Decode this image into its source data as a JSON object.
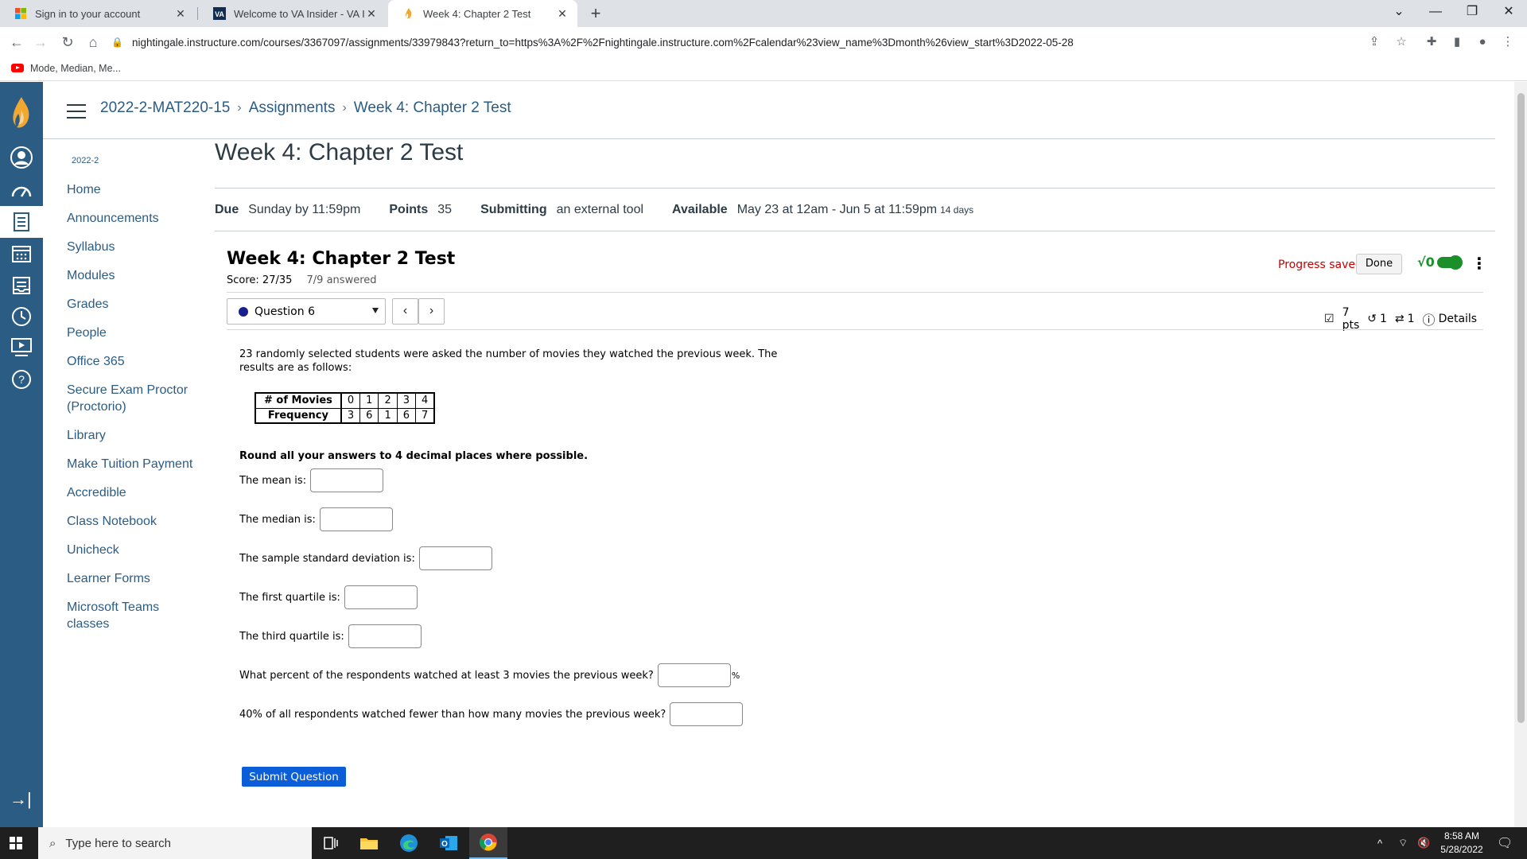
{
  "browser": {
    "tabs": [
      {
        "title": "Sign in to your account",
        "close": "✕"
      },
      {
        "title": "Welcome to VA Insider - VA INSI",
        "close": "✕"
      },
      {
        "title": "Week 4: Chapter 2 Test",
        "close": "✕"
      }
    ],
    "new_tab": "+",
    "url": "nightingale.instructure.com/courses/3367097/assignments/33979843?return_to=https%3A%2F%2Fnightingale.instructure.com%2Fcalendar%23view_name%3Dmonth%26view_start%3D2022-05-28",
    "bookmarks": [
      {
        "label": "Mode, Median, Me..."
      }
    ],
    "window_controls": {
      "chevron": "⌄",
      "minimize": "—",
      "restore": "❐",
      "close": "✕"
    },
    "va_favicon": "VA"
  },
  "canvas": {
    "breadcrumbs": [
      "2022-2-MAT220-15",
      "Assignments",
      "Week 4: Chapter 2 Test"
    ],
    "breadcrumb_sep": "›",
    "term": "2022-2",
    "course_nav": [
      "Home",
      "Announcements",
      "Syllabus",
      "Modules",
      "Grades",
      "People",
      "Office 365",
      "Secure Exam Proctor (Proctorio)",
      "Library",
      "Make Tuition Payment",
      "Accredible",
      "Class Notebook",
      "Unicheck",
      "Learner Forms",
      "Microsoft Teams classes"
    ],
    "page_title": "Week 4: Chapter 2 Test",
    "meta": {
      "due_label": "Due",
      "due_value": "Sunday by 11:59pm",
      "points_label": "Points",
      "points_value": "35",
      "submitting_label": "Submitting",
      "submitting_value": "an external tool",
      "available_label": "Available",
      "available_value": "May 23 at 12am - Jun 5 at 11:59pm",
      "available_days": "14 days"
    },
    "collapse_icon": "→|"
  },
  "tool": {
    "title": "Week 4: Chapter 2 Test",
    "score": "Score: 27/35",
    "answered": "7/9 answered",
    "progress_saved": "Progress saved",
    "done_label": "Done",
    "math_label": "√0",
    "kebab": "⋮",
    "question_select": "Question 6",
    "prev": "‹",
    "next": "›",
    "pts": "7 pts",
    "retries": "1",
    "regens": "1",
    "details": "Details",
    "question_text": "23 randomly selected students were asked the number of movies they watched the previous week. The results are as follows:",
    "table": {
      "row1_label": "# of Movies",
      "row1": [
        "0",
        "1",
        "2",
        "3",
        "4"
      ],
      "row2_label": "Frequency",
      "row2": [
        "3",
        "6",
        "1",
        "6",
        "7"
      ]
    },
    "instruction": "Round all your answers to 4 decimal places where possible.",
    "questions": [
      {
        "label": "The mean is:",
        "value": ""
      },
      {
        "label": "The median is:",
        "value": ""
      },
      {
        "label": "The sample standard deviation is:",
        "value": ""
      },
      {
        "label": "The first quartile is:",
        "value": ""
      },
      {
        "label": "The third quartile is:",
        "value": ""
      },
      {
        "label": "What percent of the respondents watched at least 3 movies the previous week?",
        "value": "",
        "suffix": "%"
      },
      {
        "label": "40% of all respondents watched fewer than how many movies the previous week?",
        "value": ""
      }
    ],
    "submit_label": "Submit Question"
  },
  "taskbar": {
    "search_placeholder": "Type here to search",
    "time": "8:58 AM",
    "date": "5/28/2022",
    "tray_chevron": "^"
  }
}
